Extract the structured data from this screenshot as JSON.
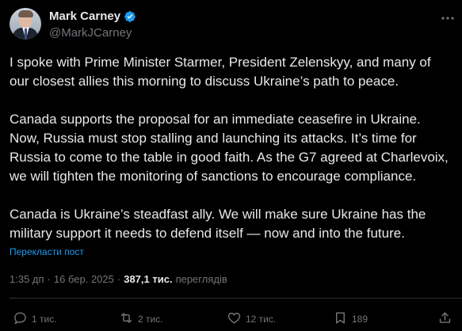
{
  "author": {
    "display_name": "Mark Carney",
    "handle": "@MarkJCarney",
    "verified": true
  },
  "tweet": {
    "text": "I spoke with Prime Minister Starmer, President Zelenskyy, and many of\nour closest allies this morning to discuss Ukraine’s path to peace.\n\nCanada supports the proposal for an immediate ceasefire in Ukraine.\nNow, Russia must stop stalling and launching its attacks. It’s time for\nRussia to come to the table in good faith. As the G7 agreed at Charlevoix,\nwe will tighten the monitoring of sanctions to encourage compliance.\n\nCanada is Ukraine’s steadfast ally. We will make sure Ukraine has the\nmilitary support it needs to defend itself — now and into the future.",
    "translate_label": "Перекласти пост"
  },
  "meta": {
    "time": "1:35 дп",
    "separator": "·",
    "date": "16 бер. 2025",
    "views_count": "387,1 тис.",
    "views_label": "переглядів"
  },
  "actions": {
    "replies": "1 тис.",
    "reposts": "2 тис.",
    "likes": "12 тис.",
    "bookmarks": "189"
  },
  "colors": {
    "background": "#000000",
    "text_primary": "#e7e9ea",
    "text_secondary": "#71767b",
    "accent": "#1d9bf0",
    "divider": "#2f3336"
  }
}
